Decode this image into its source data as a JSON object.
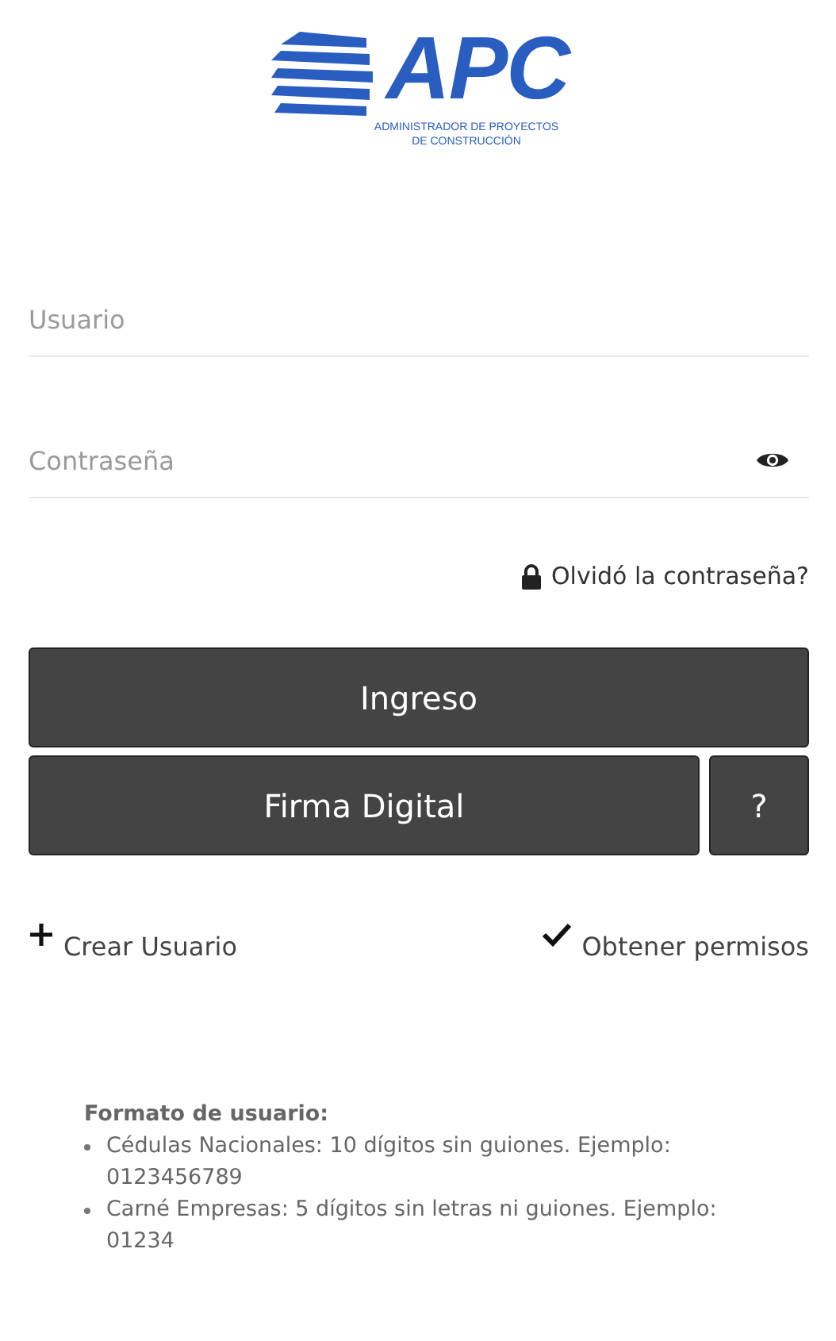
{
  "logo": {
    "name": "APC",
    "subtitle_lines": [
      "ADMINISTRADOR DE PROYECTOS",
      "DE CONSTRUCCIÓN"
    ]
  },
  "fields": [
    {
      "kind": "text",
      "placeholder": "Usuario"
    },
    {
      "kind": "password",
      "placeholder": "Contraseña"
    }
  ],
  "forgot_link": "Olvidó la contraseña?",
  "buttons": {
    "login": "Ingreso",
    "digital_signature": "Firma Digital",
    "help": "?"
  },
  "links": [
    {
      "kind": "create",
      "label": "Crear Usuario"
    },
    {
      "kind": "permissions",
      "label": "Obtener permisos"
    }
  ],
  "user_format": {
    "title": "Formato de usuario:",
    "items": [
      "Cédulas Nacionales: 10 dígitos sin guiones. Ejemplo: 0123456789",
      "Carné Empresas: 5 dígitos sin letras ni guiones. Ejemplo: 01234"
    ]
  }
}
